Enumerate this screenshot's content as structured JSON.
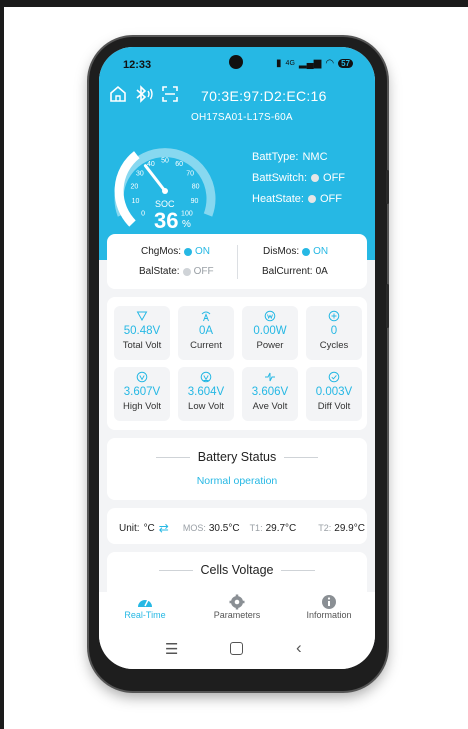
{
  "status_bar": {
    "time": "12:33",
    "signal": "4G",
    "battery": "57"
  },
  "header": {
    "mac": "70:3E:97:D2:EC:16",
    "model": "OH17SA01-L17S-60A",
    "icons": [
      "home-icon",
      "bluetooth-icon",
      "scan-icon"
    ]
  },
  "gauge": {
    "soc_label": "SOC",
    "soc_value": "36",
    "soc_unit": "%",
    "soc_fraction": 0.36,
    "ticks": [
      "0",
      "10",
      "20",
      "30",
      "40",
      "50",
      "60",
      "70",
      "80",
      "90",
      "100"
    ]
  },
  "batt_info": {
    "type_label": "BattType:",
    "type_value": "NMC",
    "switch_label": "BattSwitch:",
    "switch_value": "OFF",
    "heat_label": "HeatState:",
    "heat_value": "OFF"
  },
  "mos": {
    "chg_label": "ChgMos:",
    "chg_value": "ON",
    "dis_label": "DisMos:",
    "dis_value": "ON",
    "bal_label": "BalState:",
    "bal_value": "OFF",
    "balcur_label": "BalCurrent:",
    "balcur_value": "0A"
  },
  "stats": [
    {
      "value": "50.48V",
      "label": "Total Volt",
      "icon": "triangle-down-icon"
    },
    {
      "value": "0A",
      "label": "Current",
      "icon": "current-icon"
    },
    {
      "value": "0.00W",
      "label": "Power",
      "icon": "power-icon"
    },
    {
      "value": "0",
      "label": "Cycles",
      "icon": "cycle-icon"
    },
    {
      "value": "3.607V",
      "label": "High Volt",
      "icon": "high-volt-icon"
    },
    {
      "value": "3.604V",
      "label": "Low Volt",
      "icon": "low-volt-icon"
    },
    {
      "value": "3.606V",
      "label": "Ave Volt",
      "icon": "ave-volt-icon"
    },
    {
      "value": "0.003V",
      "label": "Diff Volt",
      "icon": "diff-volt-icon"
    }
  ],
  "battery_status": {
    "title": "Battery Status",
    "value": "Normal operation"
  },
  "temps": {
    "unit_label": "Unit:",
    "unit_value": "°C",
    "mos_label": "MOS:",
    "mos_value": "30.5°C",
    "t1_label": "T1:",
    "t1_value": "29.7°C",
    "t2_label": "T2:",
    "t2_value": "29.9°C"
  },
  "cells": {
    "title": "Cells Voltage"
  },
  "nav": [
    {
      "label": "Real-Time"
    },
    {
      "label": "Parameters"
    },
    {
      "label": "Information"
    }
  ],
  "colors": {
    "accent": "#26b8e4",
    "background": "#f3f4f6",
    "phone": "#1e1e1e"
  }
}
